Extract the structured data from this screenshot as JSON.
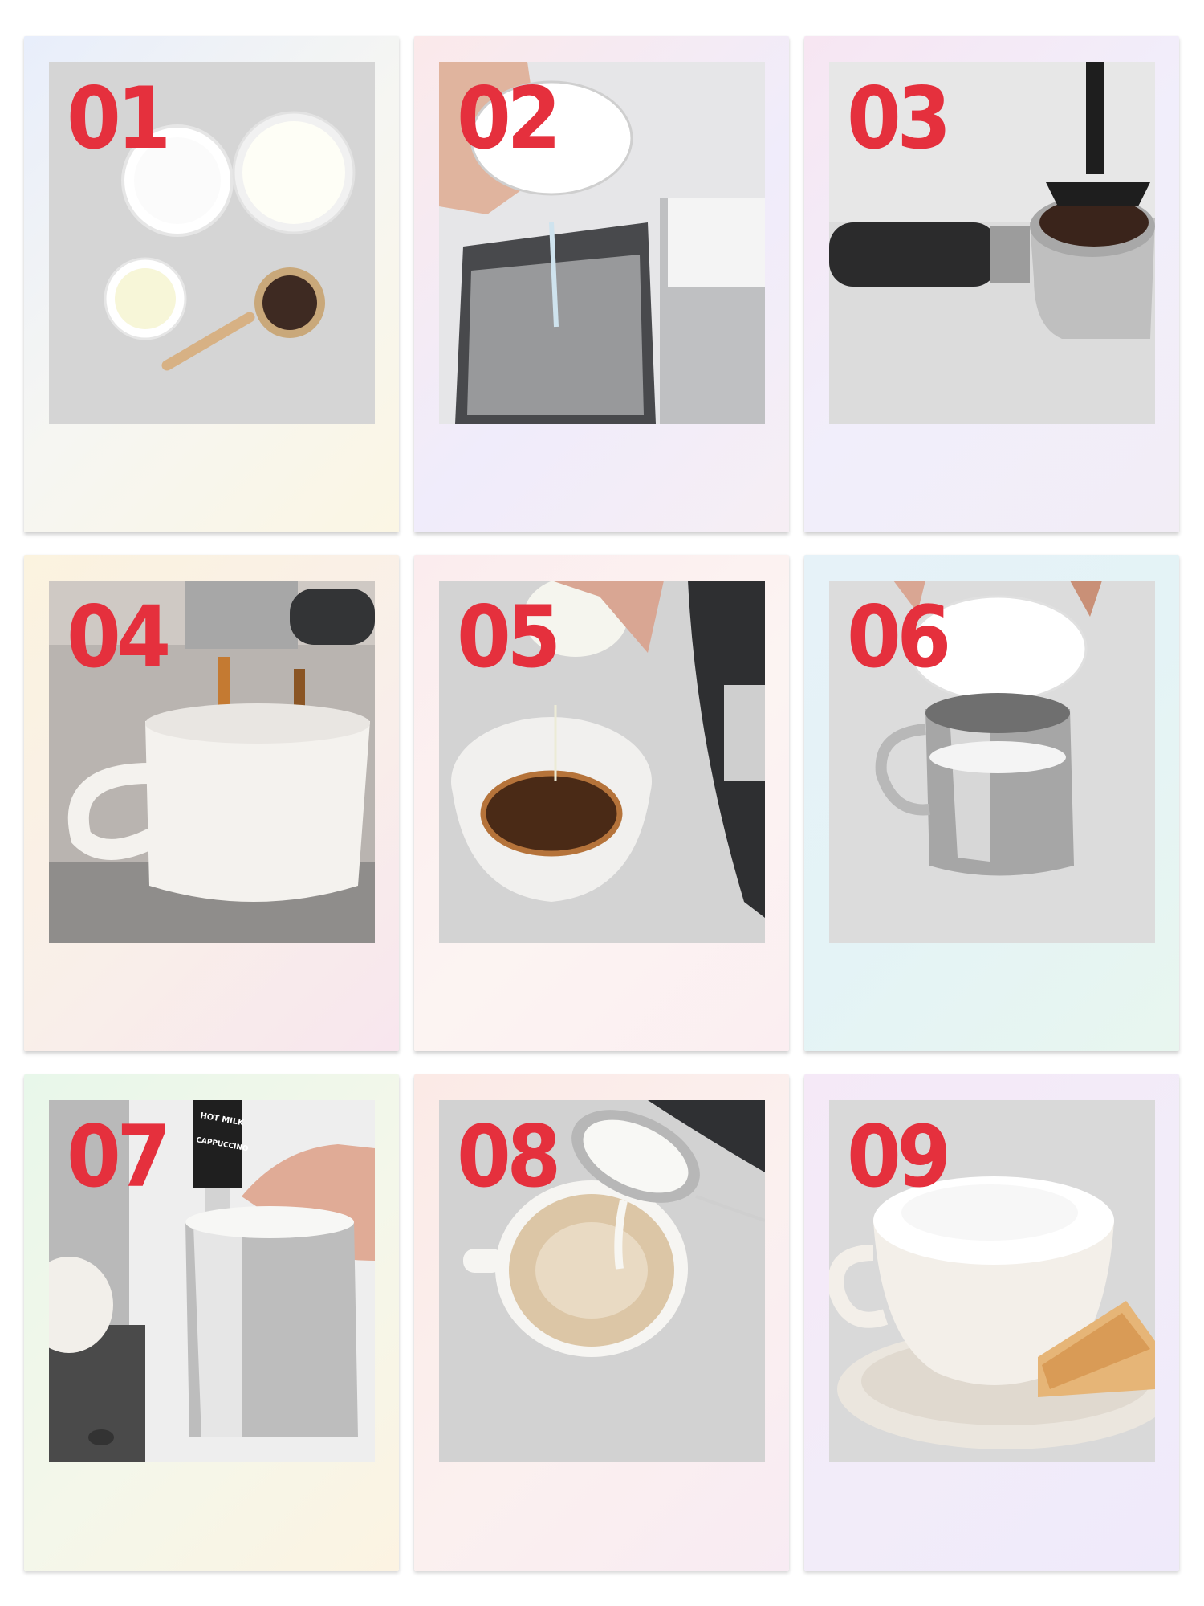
{
  "steps": [
    {
      "number": "01"
    },
    {
      "number": "02"
    },
    {
      "number": "03"
    },
    {
      "number": "04"
    },
    {
      "number": "05"
    },
    {
      "number": "06"
    },
    {
      "number": "07"
    },
    {
      "number": "08"
    },
    {
      "number": "09"
    }
  ],
  "steamer_label_top": "HOT MILK",
  "steamer_label_bottom": "CAPPUCCINO",
  "colors": {
    "number_red": "#e5303d",
    "countertop_gray": "#d9d9d9"
  }
}
